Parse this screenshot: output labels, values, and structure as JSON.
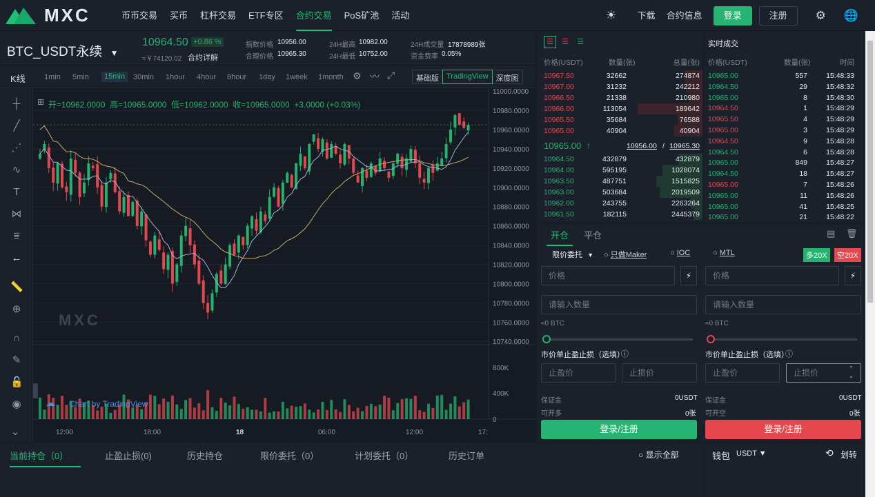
{
  "brand": {
    "name": "MXC"
  },
  "nav": {
    "items": [
      "币币交易",
      "买币",
      "杠杆交易",
      "ETF专区",
      "合约交易",
      "PoS矿池",
      "活动"
    ],
    "download": "下载",
    "contract_info": "合约信息",
    "login": "登录",
    "register": "注册"
  },
  "ticker": {
    "symbol": "BTC_USDT永续",
    "price": "10964.50",
    "change": "+0.86 %",
    "cny": "≈￥74120.02",
    "contract_detail": "合约详解",
    "index_label": "指数价格",
    "index_value": "10956.00",
    "fair_label": "合理价格",
    "fair_value": "10965.30",
    "high_label": "24H最高",
    "high_value": "10982.00",
    "low_label": "24H最低",
    "low_value": "10752.00",
    "vol_label": "24H成交量",
    "vol_value": "17878989张",
    "funding_label": "资金费率",
    "funding_value": "0.05%"
  },
  "chart_toolbar": {
    "kline": "K线",
    "timeframes": [
      "1min",
      "5min",
      "15min",
      "30min",
      "1hour",
      "4hour",
      "8hour",
      "1day",
      "1week",
      "1month"
    ],
    "active_tf": "15min",
    "basic": "基础版",
    "tradingview": "TradingView",
    "depth": "深度图"
  },
  "chart_data": {
    "type": "candlestick",
    "ohlc_label": "开=10962.0000  高=10965.0000  低=10962.0000  收=10965.0000  +3.0000 (+0.03%)",
    "y_ticks": [
      "11000.0000",
      "10980.0000",
      "10960.0000",
      "10940.0000",
      "10920.0000",
      "10900.0000",
      "10880.0000",
      "10860.0000",
      "10840.0000",
      "10820.0000",
      "10800.0000",
      "10780.0000",
      "10760.0000",
      "10740.0000"
    ],
    "ylim": [
      10740,
      11000
    ],
    "vol_ticks": [
      "800K",
      "400K",
      "0"
    ],
    "x_ticks": [
      "12:00",
      "18:00",
      "18",
      "06:00",
      "12:00",
      "17:"
    ],
    "watermark": "MXC",
    "credit": "Chart by TradingView",
    "close": [
      10935,
      10945,
      10920,
      10905,
      10925,
      10900,
      10895,
      10930,
      10915,
      10890,
      10905,
      10925,
      10920,
      10900,
      10880,
      10905,
      10915,
      10895,
      10875,
      10890,
      10870,
      10885,
      10860,
      10875,
      10845,
      10830,
      10850,
      10835,
      10815,
      10830,
      10800,
      10820,
      10850,
      10860,
      10840,
      10820,
      10800,
      10780,
      10770,
      10790,
      10810,
      10800,
      10820,
      10840,
      10830,
      10850,
      10840,
      10860,
      10870,
      10855,
      10875,
      10865,
      10890,
      10900,
      10880,
      10905,
      10915,
      10900,
      10925,
      10935,
      10920,
      10945,
      10955,
      10940,
      10950,
      10930,
      10945,
      10935,
      10925,
      10945,
      10930,
      10915,
      10905,
      10920,
      10910,
      10925,
      10915,
      10930,
      10920,
      10910,
      10925,
      10935,
      10920,
      10930,
      10940,
      10925,
      10910,
      10905,
      10920,
      10915,
      10925,
      10930,
      10945,
      10960,
      10975,
      10965,
      10962,
      10965
    ]
  },
  "orderbook": {
    "headers": [
      "价格(USDT)",
      "数量(张)",
      "总量(张)"
    ],
    "asks": [
      [
        "10967.50",
        "32662",
        "274874"
      ],
      [
        "10967.00",
        "31232",
        "242212"
      ],
      [
        "10966.50",
        "21338",
        "210980"
      ],
      [
        "10966.00",
        "113054",
        "189642"
      ],
      [
        "10965.50",
        "35684",
        "76588"
      ],
      [
        "10965.00",
        "40904",
        "40904"
      ]
    ],
    "last": "10965.00",
    "index": "10956.00",
    "fair": "10965.30",
    "bids": [
      [
        "10964.50",
        "432879",
        "432879"
      ],
      [
        "10964.00",
        "595195",
        "1028074"
      ],
      [
        "10963.50",
        "487751",
        "1515825"
      ],
      [
        "10963.00",
        "503684",
        "2019509"
      ],
      [
        "10962.00",
        "243755",
        "2263264"
      ],
      [
        "10961.50",
        "182115",
        "2445379"
      ]
    ],
    "ask_depth": [
      0.11,
      0.1,
      0.08,
      0.39,
      0.15,
      0.17
    ],
    "bid_depth": [
      0.14,
      0.24,
      0.28,
      0.26,
      0.07,
      0.05
    ]
  },
  "trades": {
    "title": "实时成交",
    "headers": [
      "价格(USDT)",
      "数量(张)",
      "时间"
    ],
    "rows": [
      [
        "10965.00",
        "557",
        "15:48:33",
        "g"
      ],
      [
        "10964.50",
        "29",
        "15:48:32",
        "g"
      ],
      [
        "10965.00",
        "8",
        "15:48:30",
        "g"
      ],
      [
        "10964.50",
        "1",
        "15:48:29",
        "r"
      ],
      [
        "10965.50",
        "4",
        "15:48:29",
        "r"
      ],
      [
        "10965.00",
        "3",
        "15:48:29",
        "r"
      ],
      [
        "10964.50",
        "9",
        "15:48:28",
        "r"
      ],
      [
        "10964.50",
        "6",
        "15:48:28",
        "g"
      ],
      [
        "10965.00",
        "849",
        "15:48:27",
        "g"
      ],
      [
        "10964.50",
        "18",
        "15:48:27",
        "g"
      ],
      [
        "10965.00",
        "7",
        "15:48:26",
        "r"
      ],
      [
        "10965.00",
        "11",
        "15:48:26",
        "g"
      ],
      [
        "10965.00",
        "41",
        "15:48:25",
        "g"
      ],
      [
        "10965.00",
        "21",
        "15:48:22",
        "g"
      ]
    ]
  },
  "orderform": {
    "tab_open": "开仓",
    "tab_close": "平仓",
    "type": "限价委托",
    "maker": "只做Maker",
    "ioc": "IOC",
    "mtl": "MTL",
    "long_lev": "多20X",
    "short_lev": "空20X",
    "price_ph": "价格",
    "qty_ph": "请输入数量",
    "avail_btc": "≈0 BTC",
    "tpsl": "市价单止盈止损（选填）",
    "tp_ph": "止盈价",
    "sl_ph": "止损价",
    "margin": "保证金",
    "margin_val": "0USDT",
    "can_long": "可开多",
    "can_short": "可开空",
    "can_val": "0张",
    "login_btn": "登录/注册"
  },
  "bottom": {
    "tabs": [
      "当前持仓（0）",
      "止盈止损(0)",
      "历史持仓",
      "限价委托（0）",
      "计划委托（0）",
      "历史订单"
    ],
    "show_all": "显示全部"
  },
  "wallet": {
    "label": "钱包",
    "currency": "USDT",
    "transfer": "划转"
  },
  "colors": {
    "green": "#23b36d",
    "red": "#e5474f",
    "bg": "#1b212b"
  }
}
